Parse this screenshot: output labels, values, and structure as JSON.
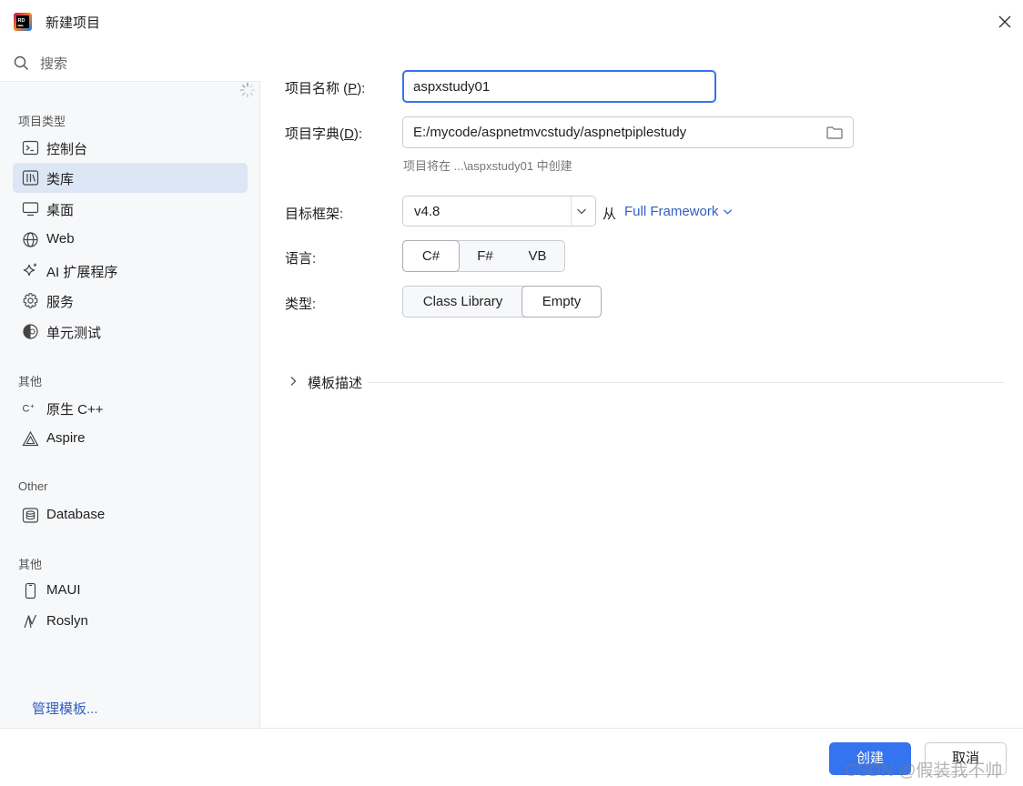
{
  "window": {
    "title": "新建项目",
    "app_icon": "rider-logo-icon",
    "close_icon": "close-icon"
  },
  "sidebar": {
    "search_placeholder": "搜索",
    "groups": [
      {
        "header": "项目类型",
        "items": [
          {
            "label": "控制台",
            "icon": "console-icon"
          },
          {
            "label": "类库",
            "icon": "library-icon",
            "selected": true
          },
          {
            "label": "桌面",
            "icon": "desktop-icon"
          },
          {
            "label": "Web",
            "icon": "globe-icon"
          },
          {
            "label": "AI 扩展程序",
            "icon": "sparkle-icon"
          },
          {
            "label": "服务",
            "icon": "gear-icon"
          },
          {
            "label": "单元测试",
            "icon": "unit-test-icon"
          }
        ]
      },
      {
        "header": "其他",
        "items": [
          {
            "label": "原生 C++",
            "icon": "cpp-icon"
          },
          {
            "label": "Aspire",
            "icon": "aspire-icon"
          }
        ]
      },
      {
        "header": "Other",
        "items": [
          {
            "label": "Database",
            "icon": "database-icon"
          }
        ]
      },
      {
        "header": "其他",
        "items": [
          {
            "label": "MAUI",
            "icon": "mobile-icon"
          },
          {
            "label": "Roslyn",
            "icon": "roslyn-icon"
          }
        ]
      }
    ],
    "manage_templates": "管理模板..."
  },
  "form": {
    "project_name": {
      "label_pre": "项目名称 (",
      "mnemonic": "P",
      "label_post": "):",
      "value": "aspxstudy01"
    },
    "project_dir": {
      "label_pre": "项目字典(",
      "mnemonic": "D",
      "label_post": "):",
      "value": "E:/mycode/aspnetmvcstudy/aspnetpiplestudy",
      "hint": "项目将在 ...\\aspxstudy01 中创建"
    },
    "target_framework": {
      "label": "目标框架:",
      "value": "v4.8",
      "from_label": "从",
      "framework_link": "Full Framework"
    },
    "language": {
      "label": "语言:",
      "options": [
        "C#",
        "F#",
        "VB"
      ],
      "selected": "C#"
    },
    "type": {
      "label": "类型:",
      "options": [
        "Class Library",
        "Empty"
      ],
      "selected": "Empty"
    },
    "template_description": "模板描述"
  },
  "footer": {
    "create": "创建",
    "cancel": "取消",
    "watermark": "CSDN @假装我不帅"
  },
  "colors": {
    "accent": "#3574f0",
    "link": "#2f5fbf",
    "selected_bg": "#dde6f5"
  }
}
